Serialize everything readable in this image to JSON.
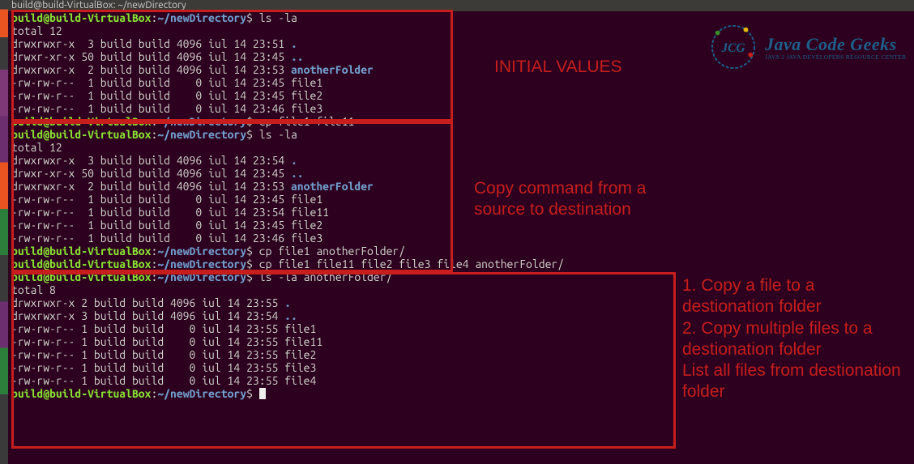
{
  "window": {
    "title": "build@build-VirtualBox: ~/newDirectory"
  },
  "prompt": {
    "user": "build@build-VirtualBox",
    "colon": ":",
    "path": "~/newDirectory",
    "dollar": "$ "
  },
  "blocks": {
    "b0": {
      "cmd0": "ls -la",
      "total": "total 12",
      "rows": [
        {
          "perm": "drwxrwxr-x",
          "n": "3",
          "u": "build",
          "g": "build",
          "sz": "4096",
          "d": "iul 14 23:51",
          "name": ".",
          "dir": true
        },
        {
          "perm": "drwxr-xr-x",
          "n": "50",
          "u": "build",
          "g": "build",
          "sz": "4096",
          "d": "iul 14 23:45",
          "name": "..",
          "dir": true
        },
        {
          "perm": "drwxrwxr-x",
          "n": "2",
          "u": "build",
          "g": "build",
          "sz": "4096",
          "d": "iul 14 23:53",
          "name": "anotherFolder",
          "dir": true
        },
        {
          "perm": "-rw-rw-r--",
          "n": "1",
          "u": "build",
          "g": "build",
          "sz": "0",
          "d": "iul 14 23:45",
          "name": "file1"
        },
        {
          "perm": "-rw-rw-r--",
          "n": "1",
          "u": "build",
          "g": "build",
          "sz": "0",
          "d": "iul 14 23:45",
          "name": "file2"
        },
        {
          "perm": "-rw-rw-r--",
          "n": "1",
          "u": "build",
          "g": "build",
          "sz": "0",
          "d": "iul 14 23:46",
          "name": "file3"
        }
      ]
    },
    "b1": {
      "cmd0": "cp file1 file11",
      "cmd1": "ls -la",
      "total": "total 12",
      "rows": [
        {
          "perm": "drwxrwxr-x",
          "n": "3",
          "u": "build",
          "g": "build",
          "sz": "4096",
          "d": "iul 14 23:54",
          "name": ".",
          "dir": true
        },
        {
          "perm": "drwxr-xr-x",
          "n": "50",
          "u": "build",
          "g": "build",
          "sz": "4096",
          "d": "iul 14 23:45",
          "name": "..",
          "dir": true
        },
        {
          "perm": "drwxrwxr-x",
          "n": "2",
          "u": "build",
          "g": "build",
          "sz": "4096",
          "d": "iul 14 23:53",
          "name": "anotherFolder",
          "dir": true
        },
        {
          "perm": "-rw-rw-r--",
          "n": "1",
          "u": "build",
          "g": "build",
          "sz": "0",
          "d": "iul 14 23:45",
          "name": "file1"
        },
        {
          "perm": "-rw-rw-r--",
          "n": "1",
          "u": "build",
          "g": "build",
          "sz": "0",
          "d": "iul 14 23:54",
          "name": "file11"
        },
        {
          "perm": "-rw-rw-r--",
          "n": "1",
          "u": "build",
          "g": "build",
          "sz": "0",
          "d": "iul 14 23:45",
          "name": "file2"
        },
        {
          "perm": "-rw-rw-r--",
          "n": "1",
          "u": "build",
          "g": "build",
          "sz": "0",
          "d": "iul 14 23:46",
          "name": "file3"
        }
      ]
    },
    "b2": {
      "cmd0": "cp file1 anotherFolder/",
      "cmd1": "cp file1 file11 file2 file3 file4 anotherFolder/",
      "cmd2": "ls -la anotherFolder/",
      "total": "total 8",
      "rows": [
        {
          "perm": "drwxrwxr-x",
          "n": "2",
          "u": "build",
          "g": "build",
          "sz": "4096",
          "d": "iul 14 23:55",
          "name": ".",
          "dir": true
        },
        {
          "perm": "drwxrwxr-x",
          "n": "3",
          "u": "build",
          "g": "build",
          "sz": "4096",
          "d": "iul 14 23:54",
          "name": "..",
          "dir": true
        },
        {
          "perm": "-rw-rw-r--",
          "n": "1",
          "u": "build",
          "g": "build",
          "sz": "0",
          "d": "iul 14 23:55",
          "name": "file1"
        },
        {
          "perm": "-rw-rw-r--",
          "n": "1",
          "u": "build",
          "g": "build",
          "sz": "0",
          "d": "iul 14 23:55",
          "name": "file11"
        },
        {
          "perm": "-rw-rw-r--",
          "n": "1",
          "u": "build",
          "g": "build",
          "sz": "0",
          "d": "iul 14 23:55",
          "name": "file2"
        },
        {
          "perm": "-rw-rw-r--",
          "n": "1",
          "u": "build",
          "g": "build",
          "sz": "0",
          "d": "iul 14 23:55",
          "name": "file3"
        },
        {
          "perm": "-rw-rw-r--",
          "n": "1",
          "u": "build",
          "g": "build",
          "sz": "0",
          "d": "iul 14 23:55",
          "name": "file4"
        }
      ]
    }
  },
  "annotations": {
    "a0": "INITIAL VALUES",
    "a1": "Copy command from a source to destination",
    "a2": "1. Copy a file to a destionation folder\n2. Copy multiple files to a destionation folder\nList all files from destionation folder"
  },
  "logo": {
    "badge": "JCG",
    "title": "Java Code Geeks",
    "subtitle": "JAVA 2 JAVA DEVELOPERS RESOURCE CENTER"
  }
}
